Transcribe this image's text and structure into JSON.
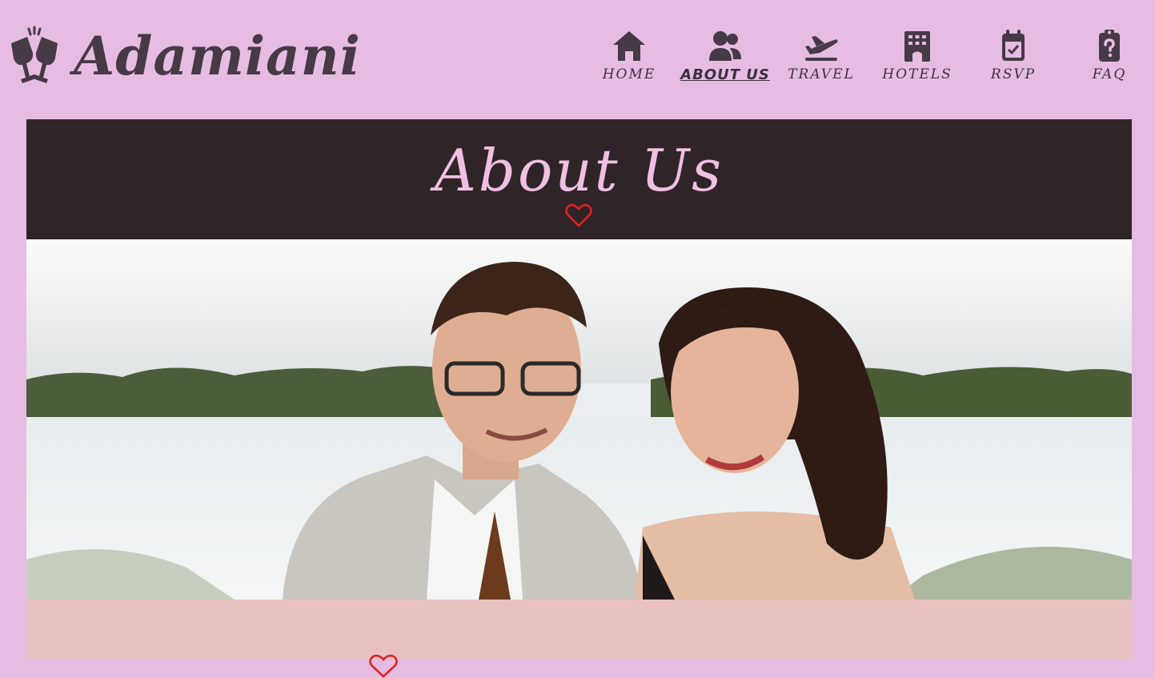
{
  "brand": {
    "name": "Adamiani",
    "icon": "champagne-glasses-icon"
  },
  "nav": {
    "items": [
      {
        "label": "HOME",
        "icon": "home-icon",
        "active": false
      },
      {
        "label": "ABOUT US",
        "icon": "users-icon",
        "active": true
      },
      {
        "label": "TRAVEL",
        "icon": "plane-departure-icon",
        "active": false
      },
      {
        "label": "HOTELS",
        "icon": "hotel-icon",
        "active": false
      },
      {
        "label": "RSVP",
        "icon": "calendar-check-icon",
        "active": false
      },
      {
        "label": "FAQ",
        "icon": "clipboard-question-icon",
        "active": false
      }
    ]
  },
  "about": {
    "title": "About Us",
    "divider_icon": "heart-outline-icon"
  },
  "photo": {
    "subject": "couple-photo"
  },
  "colors": {
    "page_bg": "#e6bce2",
    "text_dark": "#463a46",
    "band_dark": "#2f2528",
    "title_pink": "#f0bfe4",
    "heart_red": "#e02222",
    "section_bg": "#e8c0c0"
  }
}
